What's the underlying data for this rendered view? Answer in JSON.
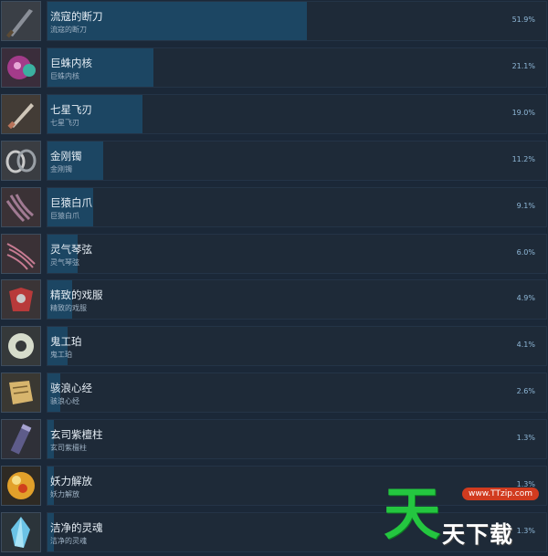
{
  "items": [
    {
      "name": "流寇的断刀",
      "desc": "流寇的断刀",
      "percent": 51.9,
      "percent_label": "51.9%",
      "icon": "broken-blade-icon",
      "color": "#8a8f98"
    },
    {
      "name": "巨蛛内核",
      "desc": "巨蛛内核",
      "percent": 21.1,
      "percent_label": "21.1%",
      "icon": "spider-core-icon",
      "color": "#a33b8a"
    },
    {
      "name": "七星飞刃",
      "desc": "七星飞刃",
      "percent": 19.0,
      "percent_label": "19.0%",
      "icon": "throwing-knife-icon",
      "color": "#b8735a"
    },
    {
      "name": "金刚镯",
      "desc": "金刚镯",
      "percent": 11.2,
      "percent_label": "11.2%",
      "icon": "bangle-icon",
      "color": "#c9c9c9"
    },
    {
      "name": "巨猿白爪",
      "desc": "巨猿白爪",
      "percent": 9.1,
      "percent_label": "9.1%",
      "icon": "claw-icon",
      "color": "#a07a92"
    },
    {
      "name": "灵气琴弦",
      "desc": "灵气琴弦",
      "percent": 6.0,
      "percent_label": "6.0%",
      "icon": "strings-icon",
      "color": "#c77b92"
    },
    {
      "name": "精致的戏服",
      "desc": "精致的戏服",
      "percent": 4.9,
      "percent_label": "4.9%",
      "icon": "costume-icon",
      "color": "#b83a3a"
    },
    {
      "name": "鬼工珀",
      "desc": "鬼工珀",
      "percent": 4.1,
      "percent_label": "4.1%",
      "icon": "jade-ring-icon",
      "color": "#d6dccb"
    },
    {
      "name": "骇浪心经",
      "desc": "骇浪心经",
      "percent": 2.6,
      "percent_label": "2.6%",
      "icon": "scroll-icon",
      "color": "#d7b56d"
    },
    {
      "name": "玄司紫檀柱",
      "desc": "玄司紫檀柱",
      "percent": 1.3,
      "percent_label": "1.3%",
      "icon": "pillar-icon",
      "color": "#5e5c8a"
    },
    {
      "name": "妖力解放",
      "desc": "妖力解放",
      "percent": 1.3,
      "percent_label": "1.3%",
      "icon": "orb-icon",
      "color": "#e2a02a"
    },
    {
      "name": "洁净的灵魂",
      "desc": "洁净的灵魂",
      "percent": 1.3,
      "percent_label": "1.3%",
      "icon": "crystal-icon",
      "color": "#6bc3e6"
    }
  ],
  "watermark": {
    "url": "www.TTzip.com",
    "big": "天",
    "small": "天下载"
  }
}
